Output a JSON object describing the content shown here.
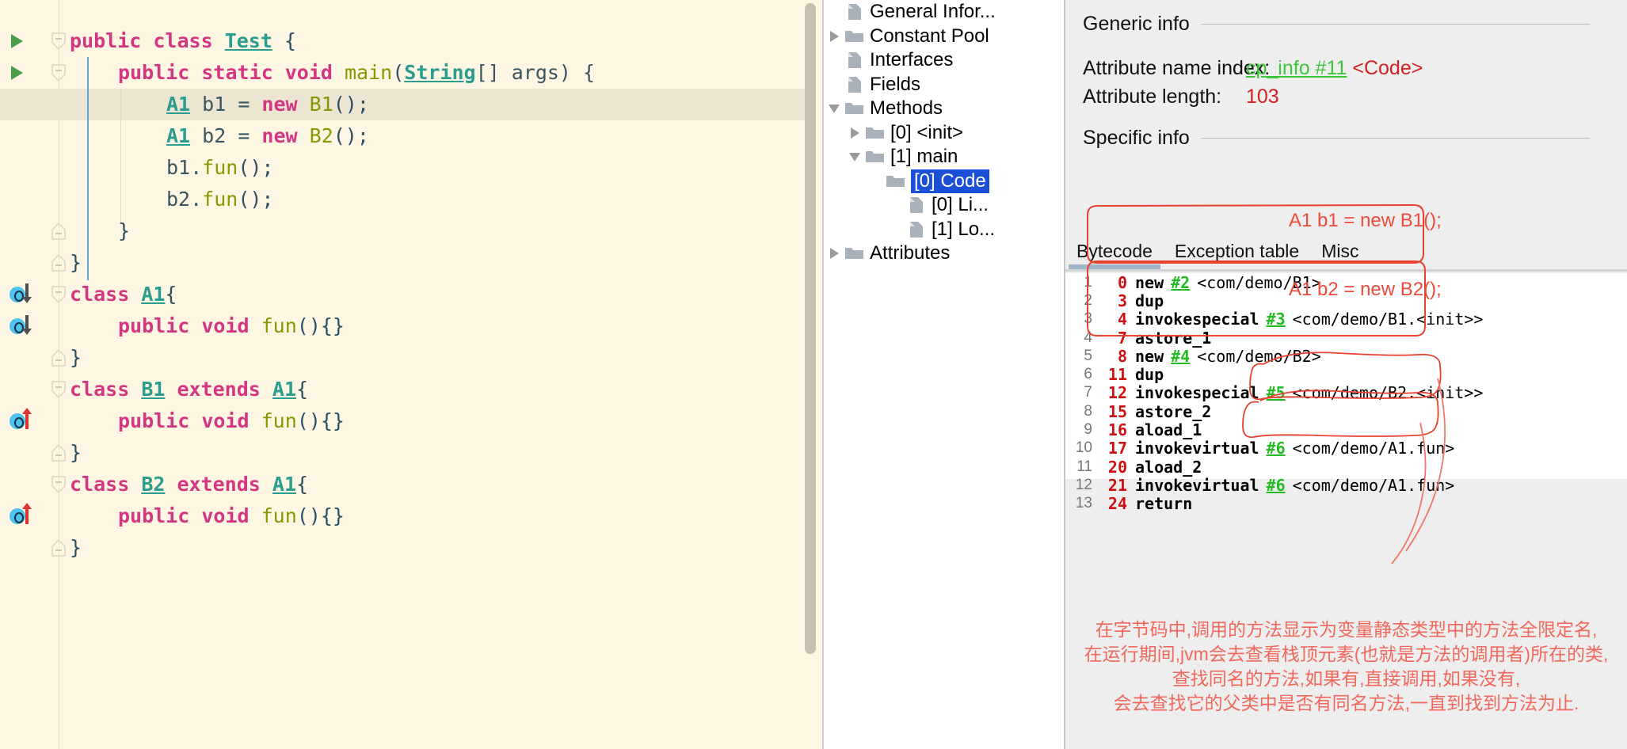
{
  "editor": {
    "lines": [
      {
        "indent": 0,
        "tokens": [
          {
            "t": "public class ",
            "c": "kw"
          },
          {
            "t": "Test",
            "c": "typ"
          },
          {
            "t": " {",
            "c": "punc"
          }
        ]
      },
      {
        "indent": 1,
        "tokens": [
          {
            "t": "public static void ",
            "c": "kw"
          },
          {
            "t": "main",
            "c": "mth"
          },
          {
            "t": "(",
            "c": "punc"
          },
          {
            "t": "String",
            "c": "typ"
          },
          {
            "t": "[] args) {",
            "c": "pln"
          }
        ]
      },
      {
        "indent": 2,
        "tokens": [
          {
            "t": "A1",
            "c": "typ"
          },
          {
            "t": " b1 = ",
            "c": "pln"
          },
          {
            "t": "new ",
            "c": "kw"
          },
          {
            "t": "B1",
            "c": "mth"
          },
          {
            "t": "();",
            "c": "punc"
          }
        ]
      },
      {
        "indent": 2,
        "tokens": [
          {
            "t": "A1",
            "c": "typ"
          },
          {
            "t": " b2 = ",
            "c": "pln"
          },
          {
            "t": "new ",
            "c": "kw"
          },
          {
            "t": "B2",
            "c": "mth"
          },
          {
            "t": "();",
            "c": "punc"
          }
        ]
      },
      {
        "indent": 2,
        "tokens": [
          {
            "t": "b1.",
            "c": "pln"
          },
          {
            "t": "fun",
            "c": "mth"
          },
          {
            "t": "();",
            "c": "punc"
          }
        ]
      },
      {
        "indent": 2,
        "tokens": [
          {
            "t": "b2.",
            "c": "pln"
          },
          {
            "t": "fun",
            "c": "mth"
          },
          {
            "t": "();",
            "c": "punc"
          }
        ]
      },
      {
        "indent": 1,
        "tokens": [
          {
            "t": "}",
            "c": "punc"
          }
        ]
      },
      {
        "indent": 0,
        "tokens": [
          {
            "t": "}",
            "c": "punc"
          }
        ]
      },
      {
        "indent": 0,
        "tokens": [
          {
            "t": "class ",
            "c": "kw"
          },
          {
            "t": "A1",
            "c": "typ"
          },
          {
            "t": "{",
            "c": "punc"
          }
        ]
      },
      {
        "indent": 1,
        "tokens": [
          {
            "t": "public void ",
            "c": "kw"
          },
          {
            "t": "fun",
            "c": "mth"
          },
          {
            "t": "(){}",
            "c": "punc"
          }
        ]
      },
      {
        "indent": 0,
        "tokens": [
          {
            "t": "}",
            "c": "punc"
          }
        ]
      },
      {
        "indent": 0,
        "tokens": [
          {
            "t": "class ",
            "c": "kw"
          },
          {
            "t": "B1",
            "c": "typ"
          },
          {
            "t": " extends ",
            "c": "kw"
          },
          {
            "t": "A1",
            "c": "typ"
          },
          {
            "t": "{",
            "c": "punc"
          }
        ]
      },
      {
        "indent": 1,
        "tokens": [
          {
            "t": "public void ",
            "c": "kw"
          },
          {
            "t": "fun",
            "c": "mth"
          },
          {
            "t": "(){}",
            "c": "punc"
          }
        ]
      },
      {
        "indent": 0,
        "tokens": [
          {
            "t": "}",
            "c": "punc"
          }
        ]
      },
      {
        "indent": 0,
        "tokens": [
          {
            "t": "class ",
            "c": "kw"
          },
          {
            "t": "B2",
            "c": "typ"
          },
          {
            "t": " extends ",
            "c": "kw"
          },
          {
            "t": "A1",
            "c": "typ"
          },
          {
            "t": "{",
            "c": "punc"
          }
        ]
      },
      {
        "indent": 1,
        "tokens": [
          {
            "t": "public void ",
            "c": "kw"
          },
          {
            "t": "fun",
            "c": "mth"
          },
          {
            "t": "(){}",
            "c": "punc"
          }
        ]
      },
      {
        "indent": 0,
        "tokens": [
          {
            "t": "}",
            "c": "punc"
          }
        ]
      }
    ],
    "gutter_markers": [
      {
        "line": 0,
        "kind": "run-class"
      },
      {
        "line": 1,
        "kind": "run-method"
      },
      {
        "line": 8,
        "kind": "overridden-down"
      },
      {
        "line": 9,
        "kind": "overridden-down"
      },
      {
        "line": 12,
        "kind": "overriding-up"
      },
      {
        "line": 15,
        "kind": "overriding-up"
      }
    ],
    "current_line": 2,
    "colors": {
      "background": "#fdf6e3",
      "current_line": "#ece5d2",
      "keyword": "#d33682",
      "type": "#2a9d8f",
      "method": "#859900",
      "plain": "#3b5560",
      "run_marker": "#4a9e4a"
    }
  },
  "tree": {
    "nodes": [
      {
        "label": "General Infor...",
        "depth": 1,
        "toggle": "none",
        "icon": "file-icon",
        "selected": false
      },
      {
        "label": "Constant Pool",
        "depth": 1,
        "toggle": "collapsed",
        "icon": "folder-icon",
        "selected": false
      },
      {
        "label": "Interfaces",
        "depth": 1,
        "toggle": "none",
        "icon": "file-icon",
        "selected": false
      },
      {
        "label": "Fields",
        "depth": 1,
        "toggle": "none",
        "icon": "file-icon",
        "selected": false
      },
      {
        "label": "Methods",
        "depth": 1,
        "toggle": "expanded",
        "icon": "folder-icon",
        "selected": false
      },
      {
        "label": "[0] <init>",
        "depth": 2,
        "toggle": "collapsed",
        "icon": "folder-icon",
        "selected": false
      },
      {
        "label": "[1] main",
        "depth": 2,
        "toggle": "expanded",
        "icon": "folder-icon",
        "selected": false
      },
      {
        "label": "[0] Code",
        "depth": 3,
        "toggle": "expanded",
        "icon": "folder-icon",
        "selected": true
      },
      {
        "label": "[0] Li...",
        "depth": 4,
        "toggle": "none",
        "icon": "file-icon",
        "selected": false
      },
      {
        "label": "[1] Lo...",
        "depth": 4,
        "toggle": "none",
        "icon": "file-icon",
        "selected": false
      },
      {
        "label": "Attributes",
        "depth": 1,
        "toggle": "collapsed",
        "icon": "folder-icon",
        "selected": false
      }
    ],
    "selection_color": "#1a4fd6"
  },
  "detail": {
    "generic_info_heading": "Generic info",
    "specific_info_heading": "Specific info",
    "attribute_name_index_label": "Attribute name index:",
    "attribute_name_index_ref": "cp_info #11",
    "attribute_name_index_value": "<Code>",
    "attribute_length_label": "Attribute length:",
    "attribute_length_value": "103",
    "tabs": [
      {
        "label": "Bytecode",
        "active": true
      },
      {
        "label": "Exception table",
        "active": false
      },
      {
        "label": "Misc",
        "active": false
      }
    ],
    "bytecode": [
      {
        "line": "1",
        "offset": "0",
        "op": "new",
        "cp": "#2",
        "arg": "<com/demo/B1>"
      },
      {
        "line": "2",
        "offset": "3",
        "op": "dup",
        "cp": "",
        "arg": ""
      },
      {
        "line": "3",
        "offset": "4",
        "op": "invokespecial",
        "cp": "#3",
        "arg": "<com/demo/B1.<init>>"
      },
      {
        "line": "4",
        "offset": "7",
        "op": "astore_1",
        "cp": "",
        "arg": ""
      },
      {
        "line": "5",
        "offset": "8",
        "op": "new",
        "cp": "#4",
        "arg": "<com/demo/B2>"
      },
      {
        "line": "6",
        "offset": "11",
        "op": "dup",
        "cp": "",
        "arg": ""
      },
      {
        "line": "7",
        "offset": "12",
        "op": "invokespecial",
        "cp": "#5",
        "arg": "<com/demo/B2.<init>>"
      },
      {
        "line": "8",
        "offset": "15",
        "op": "astore_2",
        "cp": "",
        "arg": ""
      },
      {
        "line": "9",
        "offset": "16",
        "op": "aload_1",
        "cp": "",
        "arg": ""
      },
      {
        "line": "10",
        "offset": "17",
        "op": "invokevirtual",
        "cp": "#6",
        "arg": "<com/demo/A1.fun>"
      },
      {
        "line": "11",
        "offset": "20",
        "op": "aload_2",
        "cp": "",
        "arg": ""
      },
      {
        "line": "12",
        "offset": "21",
        "op": "invokevirtual",
        "cp": "#6",
        "arg": "<com/demo/A1.fun>"
      },
      {
        "line": "13",
        "offset": "24",
        "op": "return",
        "cp": "",
        "arg": ""
      }
    ],
    "annotations": {
      "callout_1": "A1 b1 = new B1();",
      "callout_2": "A1 b2 = new B2();",
      "note_lines": [
        "在字节码中,调用的方法显示为变量静态类型中的方法全限定名,",
        "在运行期间,jvm会去查看栈顶元素(也就是方法的调用者)所在的类,",
        "查找同名的方法,如果有,直接调用,如果没有,",
        "会去查找它的父类中是否有同名方法,一直到找到方法为止."
      ],
      "color": "#ef4a3a"
    }
  }
}
